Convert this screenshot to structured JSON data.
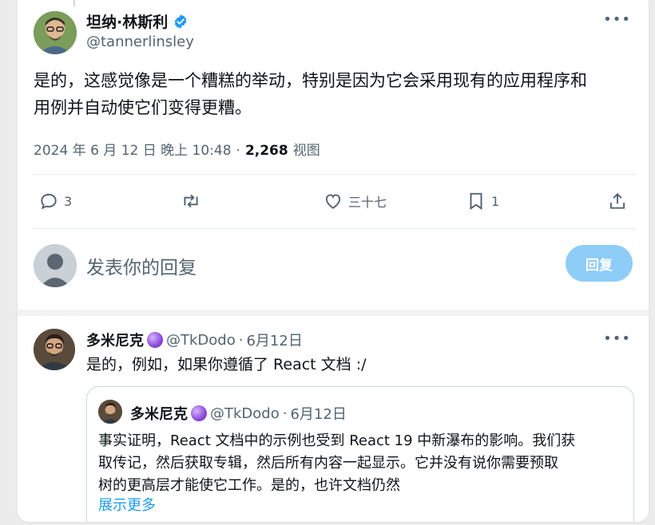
{
  "tweet": {
    "author_name": "坦纳·林斯利",
    "author_handle": "@tannerlinsley",
    "text_line1": "是的，这感觉像是一个糟糕的举动，特别是因为它会采用现有的应用程序和",
    "text_line2": "用例并自动使它们变得更糟。",
    "timestamp": "2024 年 6 月 12 日 晚上 10:48",
    "separator": "·",
    "views_count": "2,268",
    "views_label": "视图"
  },
  "actions": {
    "reply_count": "3",
    "like_count": "三十七",
    "bookmark_count": "1"
  },
  "reply_box": {
    "placeholder": "发表你的回复",
    "button_label": "回复"
  },
  "reply": {
    "author_name": "多米尼克",
    "author_handle": "@TkDodo",
    "date": "6月12日",
    "separator": "·",
    "text": "是的，例如，如果你遵循了 React 文档 :/",
    "quote": {
      "author_name": "多米尼克",
      "author_handle": "@TkDodo",
      "date": "6月12日",
      "separator": "·",
      "line1": "事实证明，React 文档中的示例也受到 React 19 中新瀑布的影响。我们获",
      "line2": "取传记，然后获取专辑，然后所有内容一起显示。它并没有说你需要预取",
      "line3": "树的更高层才能使它工作。是的，也许文档仍然",
      "show_more": "展示更多"
    }
  },
  "icons": {
    "more": "more-horizontal-icon",
    "verified": "verified-badge-icon",
    "reply": "comment-icon",
    "retweet": "retweet-icon",
    "like": "heart-icon",
    "bookmark": "bookmark-icon",
    "share": "share-icon",
    "badge": "crystal-ball-icon"
  },
  "colors": {
    "accent": "#1d9bf0",
    "reply_button": "#8ecdf8",
    "muted_text": "#536471"
  }
}
